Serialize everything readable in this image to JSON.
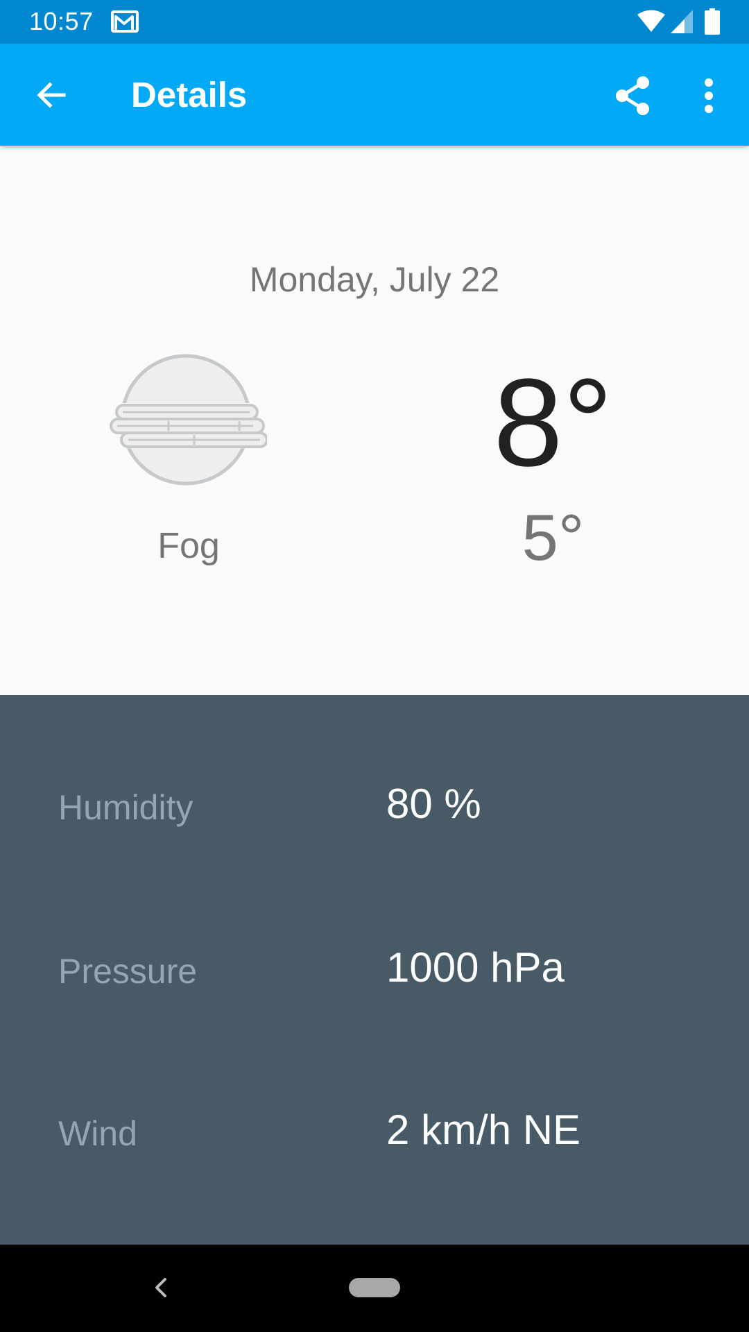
{
  "status_bar": {
    "time": "10:57",
    "icons": [
      "gmail-icon",
      "wifi-icon",
      "cell-signal-icon",
      "battery-icon"
    ]
  },
  "app_bar": {
    "title": "Details",
    "background": "#03a9f4",
    "icons": [
      "arrow-back-icon",
      "share-icon",
      "overflow-menu-icon"
    ]
  },
  "forecast": {
    "date": "Monday, July 22",
    "condition": "Fog",
    "condition_icon": "fog-icon",
    "high": "8°",
    "low": "5°"
  },
  "details": {
    "background": "#485a66",
    "items": [
      {
        "label": "Humidity",
        "value": "80 %"
      },
      {
        "label": "Pressure",
        "value": "1000 hPa"
      },
      {
        "label": "Wind",
        "value": "2 km/h NE"
      }
    ]
  },
  "nav_bar": {
    "icons": [
      "nav-back-icon",
      "nav-home-pill"
    ]
  }
}
